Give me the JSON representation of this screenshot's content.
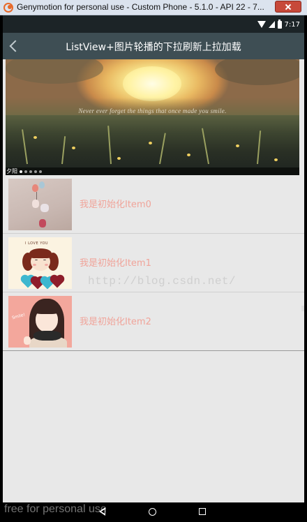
{
  "window": {
    "title": "Genymotion for personal use - Custom Phone - 5.1.0 - API 22 - 7..."
  },
  "status_bar": {
    "time": "7:17"
  },
  "action_bar": {
    "title": "ListView+图片轮播的下拉刷新上拉加载"
  },
  "banner": {
    "caption": "Never ever forget the things that once made you smile.",
    "label": "夕阳",
    "dot_count": 5,
    "active_dot": 0
  },
  "list": {
    "items": [
      {
        "label": "我是初始化Item0"
      },
      {
        "label": "我是初始化Item1"
      },
      {
        "label": "我是初始化Item2"
      }
    ]
  },
  "watermark": {
    "text": "http://blog.csdn.net/"
  },
  "nav_bar": {
    "watermark": "free for personal use"
  },
  "colors": {
    "action_bar": "#3e4e54",
    "status_bar": "#1c2427",
    "item_text": "#f0a49a",
    "background": "#e8e8e8"
  },
  "icons": {
    "window": "genymotion-icon",
    "close": "close-icon",
    "back": "back-arrow-icon",
    "wifi": "wifi-icon",
    "signal": "signal-icon",
    "battery": "battery-icon",
    "nav_back": "nav-back-icon",
    "nav_home": "nav-home-icon",
    "nav_recents": "nav-recents-icon"
  }
}
